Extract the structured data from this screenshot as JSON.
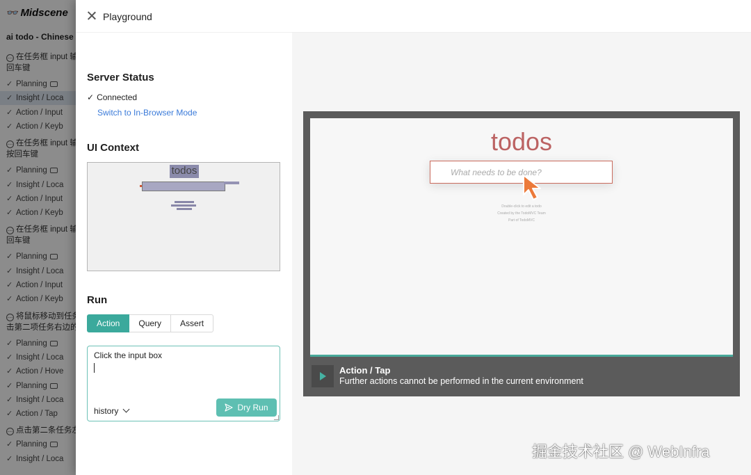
{
  "sidebar": {
    "brand": "Midscene",
    "title": "ai todo - Chinese",
    "tasks": [
      {
        "label": "在任务框 input 输",
        "label2": "回车键",
        "steps": [
          "Planning",
          "Insight / Loca",
          "Action / Input",
          "Action / Keyb"
        ]
      },
      {
        "label": "在任务框 input 输",
        "label2": "按回车键",
        "steps": [
          "Planning",
          "Insight / Loca",
          "Action / Input",
          "Action / Keyb"
        ]
      },
      {
        "label": "在任务框 input 输",
        "label2": "回车键",
        "steps": [
          "Planning",
          "Insight / Loca",
          "Action / Input",
          "Action / Keyb"
        ]
      },
      {
        "label": "将鼠标移动到任务",
        "label2": "击第二项任务右边的",
        "steps": [
          "Planning",
          "Insight / Loca",
          "Action / Hove",
          "Planning",
          "Insight / Loca",
          "Action / Tap"
        ]
      },
      {
        "label": "点击第二条任务左",
        "label2": "",
        "steps": [
          "Planning",
          "Insight / Loca"
        ]
      }
    ]
  },
  "drawer": {
    "title": "Playground",
    "server_status_title": "Server Status",
    "connected": "Connected",
    "switch_link": "Switch to In-Browser Mode",
    "ui_context_title": "UI Context",
    "ui_context_preview_text": "todos",
    "run_title": "Run",
    "tabs": [
      "Action",
      "Query",
      "Assert"
    ],
    "selected_tab": "Action",
    "prompt_value": "Click the input box",
    "history_label": "history",
    "dry_run_label": "Dry Run"
  },
  "preview": {
    "app_logo": "todos",
    "input_placeholder": "What needs to be done?",
    "footer_lines": [
      "Double-click to edit a todo",
      "Created by the TodoMVC Team",
      "Part of TodoMVC"
    ],
    "action_title": "Action / Tap",
    "action_desc": "Further actions cannot be performed in the current environment",
    "accent_color": "#3ba99c"
  },
  "watermark": "掘金技术社区 @ WebInfra"
}
